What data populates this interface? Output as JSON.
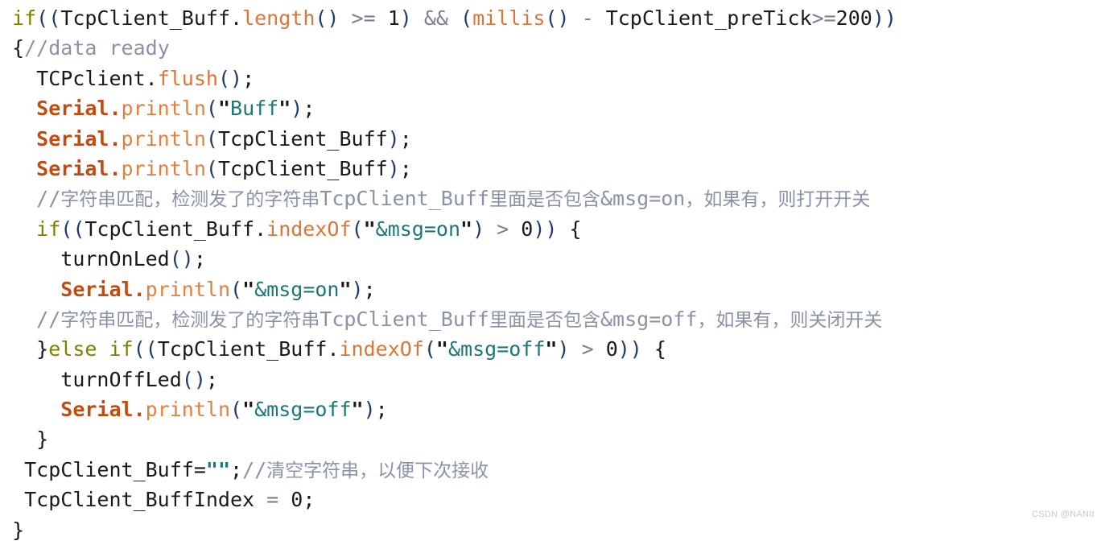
{
  "document": {
    "kind": "source-code-screenshot",
    "language": "Arduino C++",
    "watermark": "CSDN @NANIt"
  },
  "palette": {
    "background": "#ffffff",
    "plain": "#1a1a1a",
    "keyword": "#7f7f00",
    "function": "#d9763a",
    "object": "#c24b10",
    "string": "#1d7777",
    "comment": "#8a93a6",
    "punctuation": "#1f3a6e",
    "operator": "#7a8090"
  },
  "code": {
    "lines": [
      {
        "n": 1,
        "indent": " ",
        "text": "if((TcpClient_Buff.length() >= 1) && (millis() - TcpClient_preTick>=200))",
        "tokens": [
          {
            "t": "if",
            "c": "keyword"
          },
          {
            "t": "((",
            "c": "punct"
          },
          {
            "t": "TcpClient_Buff",
            "c": "plain"
          },
          {
            "t": ".",
            "c": "plain"
          },
          {
            "t": "length",
            "c": "func"
          },
          {
            "t": "()",
            "c": "punct"
          },
          {
            "t": " >= ",
            "c": "op"
          },
          {
            "t": "1",
            "c": "num"
          },
          {
            "t": ")",
            "c": "punct"
          },
          {
            "t": " && ",
            "c": "op"
          },
          {
            "t": "(",
            "c": "punct"
          },
          {
            "t": "millis",
            "c": "func"
          },
          {
            "t": "()",
            "c": "punct"
          },
          {
            "t": " - ",
            "c": "op"
          },
          {
            "t": "TcpClient_preTick",
            "c": "plain"
          },
          {
            "t": ">=",
            "c": "op"
          },
          {
            "t": "200",
            "c": "num"
          },
          {
            "t": "))",
            "c": "punct"
          }
        ]
      },
      {
        "n": 2,
        "indent": " ",
        "text": "{//data ready",
        "tokens": [
          {
            "t": "{",
            "c": "brace"
          },
          {
            "t": "//data ready",
            "c": "comment"
          }
        ]
      },
      {
        "n": 3,
        "indent": "   ",
        "text": "TCPclient.flush();",
        "tokens": [
          {
            "t": "TCPclient",
            "c": "plain"
          },
          {
            "t": ".",
            "c": "plain"
          },
          {
            "t": "flush",
            "c": "func"
          },
          {
            "t": "()",
            "c": "punct"
          },
          {
            "t": ";",
            "c": "plain"
          }
        ]
      },
      {
        "n": 4,
        "indent": "   ",
        "text": "Serial.println(\"Buff\");",
        "tokens": [
          {
            "t": "Serial",
            "c": "object"
          },
          {
            "t": ".",
            "c": "object"
          },
          {
            "t": "println",
            "c": "method"
          },
          {
            "t": "(",
            "c": "punct"
          },
          {
            "t": "\"",
            "c": "quote"
          },
          {
            "t": "Buff",
            "c": "string"
          },
          {
            "t": "\"",
            "c": "quote"
          },
          {
            "t": ")",
            "c": "punct"
          },
          {
            "t": ";",
            "c": "plain"
          }
        ]
      },
      {
        "n": 5,
        "indent": "   ",
        "text": "Serial.println(TcpClient_Buff);",
        "tokens": [
          {
            "t": "Serial",
            "c": "object"
          },
          {
            "t": ".",
            "c": "object"
          },
          {
            "t": "println",
            "c": "method"
          },
          {
            "t": "(",
            "c": "punct"
          },
          {
            "t": "TcpClient_Buff",
            "c": "plain"
          },
          {
            "t": ")",
            "c": "punct"
          },
          {
            "t": ";",
            "c": "plain"
          }
        ]
      },
      {
        "n": 6,
        "indent": "   ",
        "text": "Serial.println(TcpClient_Buff);",
        "tokens": [
          {
            "t": "Serial",
            "c": "object"
          },
          {
            "t": ".",
            "c": "object"
          },
          {
            "t": "println",
            "c": "method"
          },
          {
            "t": "(",
            "c": "punct"
          },
          {
            "t": "TcpClient_Buff",
            "c": "plain"
          },
          {
            "t": ")",
            "c": "punct"
          },
          {
            "t": ";",
            "c": "plain"
          }
        ]
      },
      {
        "n": 7,
        "indent": "   ",
        "text": "//字符串匹配，检测发了的字符串TcpClient_Buff里面是否包含&msg=on，如果有，则打开开关",
        "tokens": [
          {
            "t": "//",
            "c": "comment"
          },
          {
            "t": "字符串匹配，检测发了的字符串",
            "c": "comment-cjk"
          },
          {
            "t": "TcpClient_Buff",
            "c": "comment"
          },
          {
            "t": "里面是否包含",
            "c": "comment-cjk"
          },
          {
            "t": "&msg=on",
            "c": "comment"
          },
          {
            "t": "，如果有，则打开开关",
            "c": "comment-cjk"
          }
        ]
      },
      {
        "n": 8,
        "indent": "   ",
        "text": "if((TcpClient_Buff.indexOf(\"&msg=on\") > 0)) {",
        "tokens": [
          {
            "t": "if",
            "c": "keyword"
          },
          {
            "t": "((",
            "c": "punct"
          },
          {
            "t": "TcpClient_Buff",
            "c": "plain"
          },
          {
            "t": ".",
            "c": "plain"
          },
          {
            "t": "indexOf",
            "c": "func"
          },
          {
            "t": "(",
            "c": "punct"
          },
          {
            "t": "\"",
            "c": "quote"
          },
          {
            "t": "&msg=on",
            "c": "string"
          },
          {
            "t": "\"",
            "c": "quote"
          },
          {
            "t": ")",
            "c": "punct"
          },
          {
            "t": " > ",
            "c": "op"
          },
          {
            "t": "0",
            "c": "num"
          },
          {
            "t": "))",
            "c": "punct"
          },
          {
            "t": " {",
            "c": "brace"
          }
        ]
      },
      {
        "n": 9,
        "indent": "     ",
        "text": "turnOnLed();",
        "tokens": [
          {
            "t": "turnOnLed",
            "c": "plain"
          },
          {
            "t": "()",
            "c": "punct"
          },
          {
            "t": ";",
            "c": "plain"
          }
        ]
      },
      {
        "n": 10,
        "indent": "     ",
        "text": "Serial.println(\"&msg=on\");",
        "tokens": [
          {
            "t": "Serial",
            "c": "object"
          },
          {
            "t": ".",
            "c": "object"
          },
          {
            "t": "println",
            "c": "method"
          },
          {
            "t": "(",
            "c": "punct"
          },
          {
            "t": "\"",
            "c": "quote"
          },
          {
            "t": "&msg=on",
            "c": "string"
          },
          {
            "t": "\"",
            "c": "quote"
          },
          {
            "t": ")",
            "c": "punct"
          },
          {
            "t": ";",
            "c": "plain"
          }
        ]
      },
      {
        "n": 11,
        "indent": "   ",
        "text": "//字符串匹配，检测发了的字符串TcpClient_Buff里面是否包含&msg=off，如果有，则关闭开关",
        "tokens": [
          {
            "t": "//",
            "c": "comment"
          },
          {
            "t": "字符串匹配，检测发了的字符串",
            "c": "comment-cjk"
          },
          {
            "t": "TcpClient_Buff",
            "c": "comment"
          },
          {
            "t": "里面是否包含",
            "c": "comment-cjk"
          },
          {
            "t": "&msg=off",
            "c": "comment"
          },
          {
            "t": "，如果有，则关闭开关",
            "c": "comment-cjk"
          }
        ]
      },
      {
        "n": 12,
        "indent": "   ",
        "text": "}else if((TcpClient_Buff.indexOf(\"&msg=off\") > 0)) {",
        "tokens": [
          {
            "t": "}",
            "c": "brace"
          },
          {
            "t": "else",
            "c": "keyword"
          },
          {
            "t": " ",
            "c": "plain"
          },
          {
            "t": "if",
            "c": "keyword"
          },
          {
            "t": "((",
            "c": "punct"
          },
          {
            "t": "TcpClient_Buff",
            "c": "plain"
          },
          {
            "t": ".",
            "c": "plain"
          },
          {
            "t": "indexOf",
            "c": "func"
          },
          {
            "t": "(",
            "c": "punct"
          },
          {
            "t": "\"",
            "c": "quote"
          },
          {
            "t": "&msg=off",
            "c": "string"
          },
          {
            "t": "\"",
            "c": "quote"
          },
          {
            "t": ")",
            "c": "punct"
          },
          {
            "t": " > ",
            "c": "op"
          },
          {
            "t": "0",
            "c": "num"
          },
          {
            "t": "))",
            "c": "punct"
          },
          {
            "t": " {",
            "c": "brace"
          }
        ]
      },
      {
        "n": 13,
        "indent": "     ",
        "text": "turnOffLed();",
        "tokens": [
          {
            "t": "turnOffLed",
            "c": "plain"
          },
          {
            "t": "()",
            "c": "punct"
          },
          {
            "t": ";",
            "c": "plain"
          }
        ]
      },
      {
        "n": 14,
        "indent": "     ",
        "text": "Serial.println(\"&msg=off\");",
        "tokens": [
          {
            "t": "Serial",
            "c": "object"
          },
          {
            "t": ".",
            "c": "object"
          },
          {
            "t": "println",
            "c": "method"
          },
          {
            "t": "(",
            "c": "punct"
          },
          {
            "t": "\"",
            "c": "quote"
          },
          {
            "t": "&msg=off",
            "c": "string"
          },
          {
            "t": "\"",
            "c": "quote"
          },
          {
            "t": ")",
            "c": "punct"
          },
          {
            "t": ";",
            "c": "plain"
          }
        ]
      },
      {
        "n": 15,
        "indent": "   ",
        "text": "}",
        "tokens": [
          {
            "t": "}",
            "c": "brace"
          }
        ]
      },
      {
        "n": 16,
        "indent": "  ",
        "text": "TcpClient_Buff=\"\";//清空字符串，以便下次接收",
        "tokens": [
          {
            "t": "TcpClient_Buff",
            "c": "plain"
          },
          {
            "t": "=",
            "c": "plain"
          },
          {
            "t": "\"\"",
            "c": "emptystr"
          },
          {
            "t": ";",
            "c": "plain"
          },
          {
            "t": "//",
            "c": "comment"
          },
          {
            "t": "清空字符串，以便下次接收",
            "c": "comment-cjk"
          }
        ]
      },
      {
        "n": 17,
        "indent": "  ",
        "text": "TcpClient_BuffIndex = 0;",
        "tokens": [
          {
            "t": "TcpClient_BuffIndex",
            "c": "plain"
          },
          {
            "t": " = ",
            "c": "op"
          },
          {
            "t": "0",
            "c": "num"
          },
          {
            "t": ";",
            "c": "plain"
          }
        ]
      },
      {
        "n": 18,
        "indent": " ",
        "text": "}",
        "tokens": [
          {
            "t": "}",
            "c": "brace"
          }
        ]
      }
    ]
  }
}
